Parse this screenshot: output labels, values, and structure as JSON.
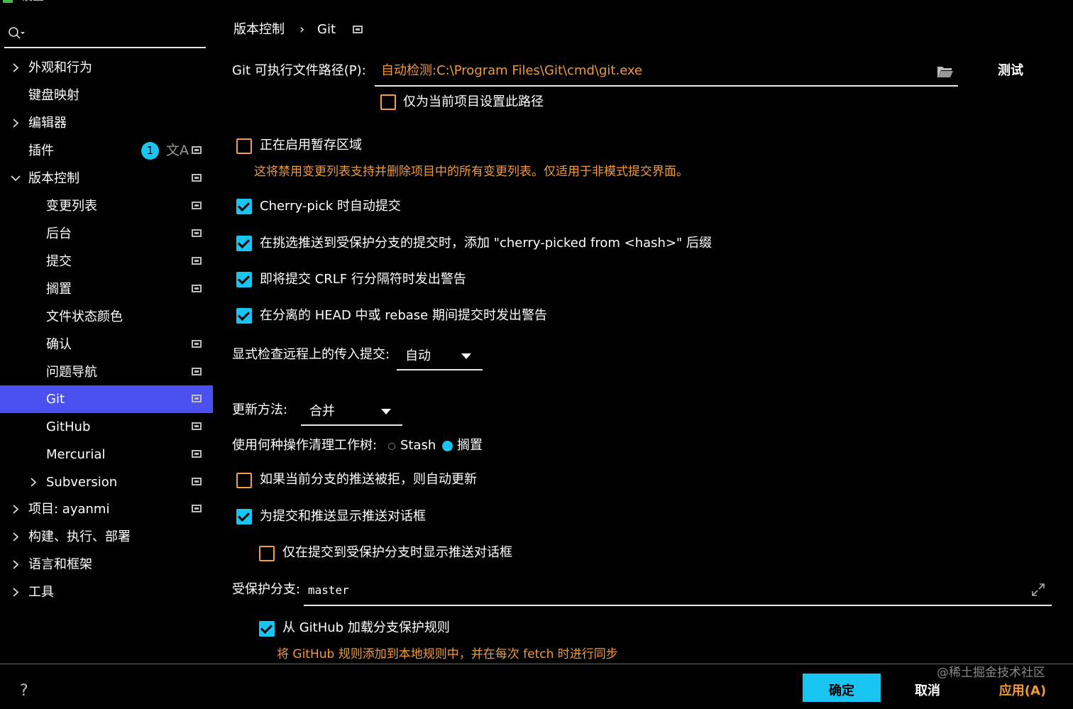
{
  "window": {
    "title": "设置"
  },
  "search": {
    "placeholder": ""
  },
  "sidebar": {
    "items": [
      {
        "label": "外观和行为"
      },
      {
        "label": "键盘映射"
      },
      {
        "label": "编辑器"
      },
      {
        "label": "插件",
        "badge": "1"
      },
      {
        "label": "版本控制"
      },
      {
        "label": "变更列表"
      },
      {
        "label": "后台"
      },
      {
        "label": "提交"
      },
      {
        "label": "搁置"
      },
      {
        "label": "文件状态颜色"
      },
      {
        "label": "确认"
      },
      {
        "label": "问题导航"
      },
      {
        "label": "Git"
      },
      {
        "label": "GitHub"
      },
      {
        "label": "Mercurial"
      },
      {
        "label": "Subversion"
      },
      {
        "label": "项目: ayanmi"
      },
      {
        "label": "构建、执行、部署"
      },
      {
        "label": "语言和框架"
      },
      {
        "label": "工具"
      }
    ]
  },
  "breadcrumb": {
    "parent": "版本控制",
    "sep": "›",
    "current": "Git"
  },
  "git_path": {
    "label": "Git 可执行文件路径(P):",
    "value": "自动检测:C:\\Program Files\\Git\\cmd\\git.exe",
    "test_button": "测试",
    "project_only": "仅为当前项目设置此路径"
  },
  "staging": {
    "label": "正在启用暂存区域",
    "hint": "这将禁用变更列表支持并删除项目中的所有变更列表。仅适用于非模式提交界面。"
  },
  "options": {
    "cherry_pick_commit": "Cherry-pick 时自动提交",
    "cherry_pick_suffix": "在挑选推送到受保护分支的提交时，添加 \"cherry-picked from <hash>\" 后缀",
    "crlf_warning": "即将提交 CRLF 行分隔符时发出警告",
    "detached_head_warning": "在分离的 HEAD 中或 rebase 期间提交时发出警告"
  },
  "incoming": {
    "label": "显式检查远程上的传入提交:",
    "value": "自动"
  },
  "update": {
    "label": "更新方法:",
    "value": "合并"
  },
  "clean": {
    "label": "使用何种操作清理工作树:",
    "stash": "Stash",
    "shelve": "搁置"
  },
  "push": {
    "auto_update": "如果当前分支的推送被拒，则自动更新",
    "show_dialog": "为提交和推送显示推送对话框",
    "protected_only": "仅在提交到受保护分支时显示推送对话框"
  },
  "protected": {
    "label": "受保护分支:",
    "value": "master",
    "github_rules": "从 GitHub 加载分支保护规则",
    "github_hint": "将 GitHub 规则添加到本地规则中，并在每次 fetch 时进行同步"
  },
  "footer": {
    "help": "?",
    "ok": "确定",
    "cancel": "取消",
    "apply": "应用(A)",
    "watermark": "@稀土掘金技术社区"
  },
  "colors": {
    "accent": "#18c4f0",
    "selection": "#4a50f0",
    "warning": "#f09a3a",
    "checkbox_off": "#f0a040"
  }
}
